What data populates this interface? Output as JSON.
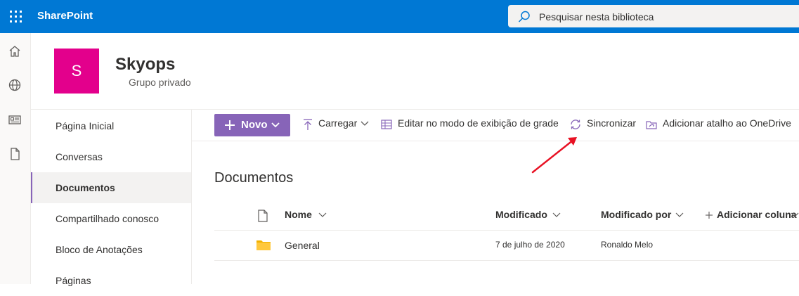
{
  "topbar": {
    "brand": "SharePoint",
    "search_placeholder": "Pesquisar nesta biblioteca"
  },
  "rail": {
    "icons": [
      "home-icon",
      "globe-icon",
      "news-icon",
      "document-icon"
    ]
  },
  "site": {
    "logo_letter": "S",
    "title": "Skyops",
    "subtitle": "Grupo privado",
    "logo_color": "#e3008c"
  },
  "nav": {
    "items": [
      {
        "label": "Página Inicial"
      },
      {
        "label": "Conversas"
      },
      {
        "label": "Documentos",
        "active": true
      },
      {
        "label": "Compartilhado conosco"
      },
      {
        "label": "Bloco de Anotações"
      },
      {
        "label": "Páginas"
      }
    ]
  },
  "commands": {
    "new_label": "Novo",
    "upload_label": "Carregar",
    "grid_edit_label": "Editar no modo de exibição de grade",
    "sync_label": "Sincronizar",
    "shortcut_label": "Adicionar atalho ao OneDrive",
    "accent": "#8764b8"
  },
  "library": {
    "title": "Documentos",
    "columns": {
      "name": "Nome",
      "modified": "Modificado",
      "modified_by": "Modificado por",
      "add_column": "Adicionar coluna"
    },
    "rows": [
      {
        "name": "General",
        "modified": "7 de julho de 2020",
        "modified_by": "Ronaldo Melo",
        "type": "folder"
      }
    ]
  },
  "colors": {
    "suite_bar": "#0078d4",
    "annotation_arrow": "#e81123"
  }
}
